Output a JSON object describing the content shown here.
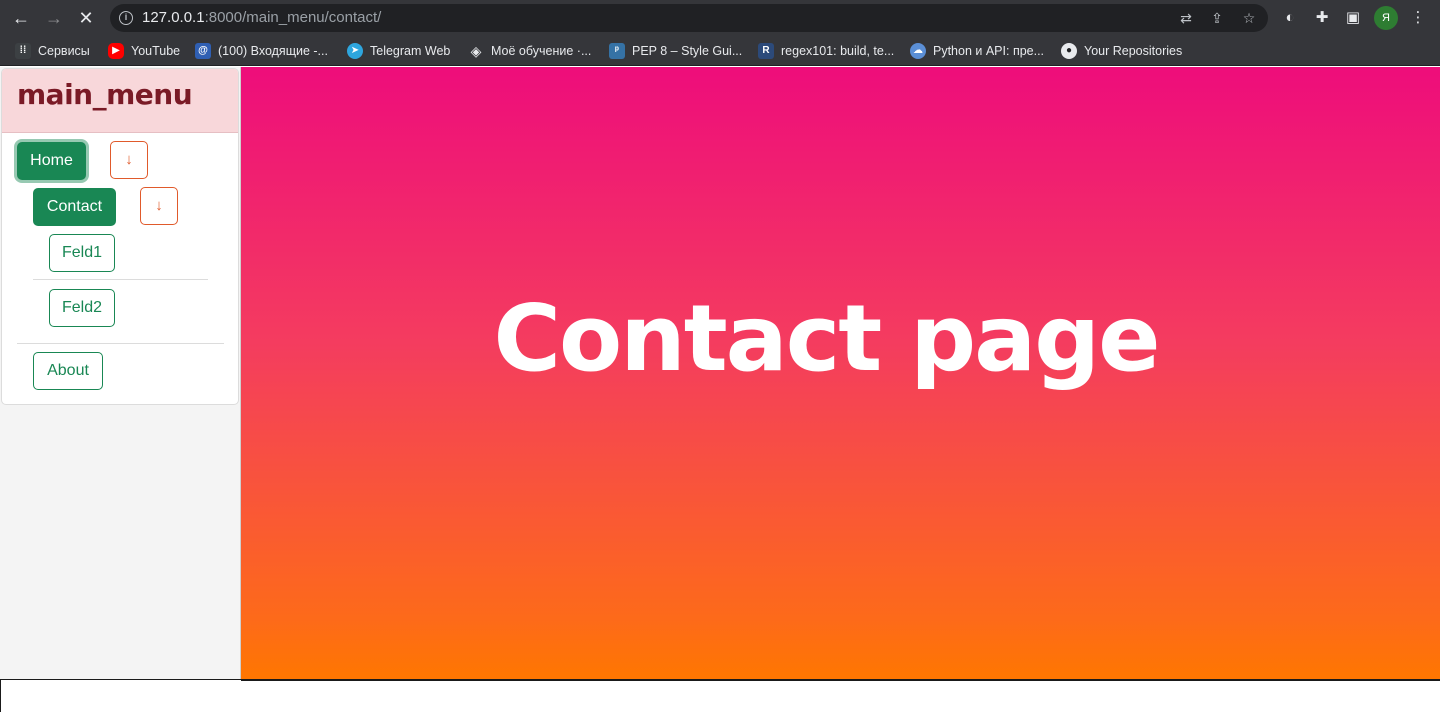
{
  "browser": {
    "nav": {
      "back_icon": "←",
      "forward_icon": "→",
      "stop_icon": "✕"
    },
    "url": {
      "host": "127.0.0.1",
      "rest": ":8000/main_menu/contact/"
    },
    "avatar_letter": "Я",
    "bookmarks": [
      {
        "label": "Сервисы",
        "color": "#ea4335"
      },
      {
        "label": "YouTube",
        "color": "#ff0000"
      },
      {
        "label": "(100) Входящие -...",
        "color": "#2f5fb3"
      },
      {
        "label": "Telegram Web",
        "color": "#2ea6de"
      },
      {
        "label": "Моё обучение ·...",
        "color": "#9aa0a6"
      },
      {
        "label": "PEP 8 – Style Gui...",
        "color": "#3572a5"
      },
      {
        "label": "regex101: build, te...",
        "color": "#2c4a7a"
      },
      {
        "label": "Python и API: пре...",
        "color": "#5b8fd6"
      },
      {
        "label": "Your Repositories",
        "color": "#e8eaed"
      }
    ]
  },
  "sidebar": {
    "brand": "main_menu",
    "home_label": "Home",
    "contact_label": "Contact",
    "feld1_label": "Feld1",
    "feld2_label": "Feld2",
    "about_label": "About",
    "arrow_glyph": "↓"
  },
  "main": {
    "title": "Contact page"
  }
}
